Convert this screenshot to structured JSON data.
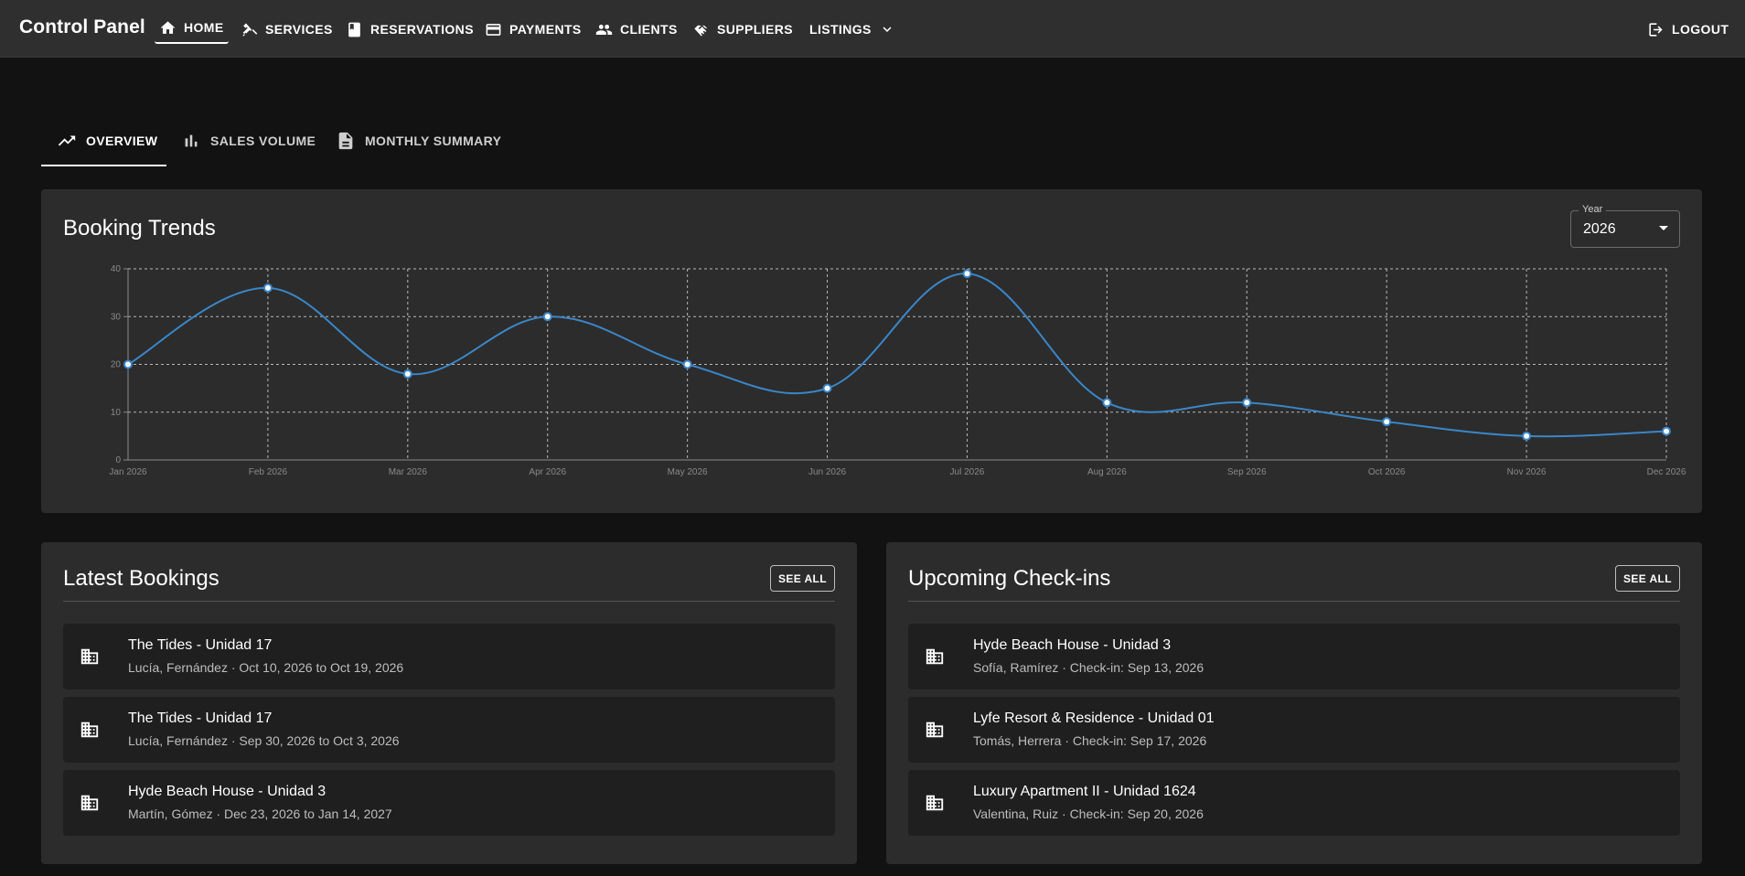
{
  "app": {
    "brand": "Control Panel",
    "nav": [
      {
        "label": "HOME",
        "icon": "home-icon"
      },
      {
        "label": "SERVICES",
        "icon": "tools-icon"
      },
      {
        "label": "RESERVATIONS",
        "icon": "book-icon"
      },
      {
        "label": "PAYMENTS",
        "icon": "credit-card-icon"
      },
      {
        "label": "CLIENTS",
        "icon": "people-icon"
      },
      {
        "label": "SUPPLIERS",
        "icon": "handshake-icon"
      },
      {
        "label": "LISTINGS",
        "icon": "chevron-down-icon"
      }
    ],
    "logout": "LOGOUT"
  },
  "tabs": [
    {
      "label": "OVERVIEW",
      "icon": "trending-up-icon"
    },
    {
      "label": "SALES VOLUME",
      "icon": "bar-chart-icon"
    },
    {
      "label": "MONTHLY SUMMARY",
      "icon": "document-icon"
    }
  ],
  "booking_trends": {
    "title": "Booking Trends",
    "year_label": "Year",
    "year_value": "2026"
  },
  "chart_data": {
    "type": "line",
    "x": [
      "Jan 2026",
      "Feb 2026",
      "Mar 2026",
      "Apr 2026",
      "May 2026",
      "Jun 2026",
      "Jul 2026",
      "Aug 2026",
      "Sep 2026",
      "Oct 2026",
      "Nov 2026",
      "Dec 2026"
    ],
    "series": [
      {
        "values": [
          20,
          36,
          18,
          30,
          20,
          15,
          39,
          12,
          12,
          8,
          5,
          6
        ]
      }
    ],
    "ylim": [
      0,
      40
    ],
    "yticks": [
      0,
      10,
      20,
      30,
      40
    ],
    "grid": true,
    "color": "#3a86c8"
  },
  "latest_bookings": {
    "title": "Latest Bookings",
    "see_all": "SEE ALL",
    "items": [
      {
        "title": "The Tides - Unidad 17",
        "subtitle": "Lucía, Fernández · Oct 10, 2026 to Oct 19, 2026"
      },
      {
        "title": "The Tides - Unidad 17",
        "subtitle": "Lucía, Fernández · Sep 30, 2026 to Oct 3, 2026"
      },
      {
        "title": "Hyde Beach House - Unidad 3",
        "subtitle": "Martín, Gómez · Dec 23, 2026 to Jan 14, 2027"
      }
    ]
  },
  "upcoming_checkins": {
    "title": "Upcoming Check-ins",
    "see_all": "SEE ALL",
    "items": [
      {
        "title": "Hyde Beach House - Unidad 3",
        "subtitle": "Sofía, Ramírez · Check-in: Sep 13, 2026"
      },
      {
        "title": "Lyfe Resort & Residence - Unidad 01",
        "subtitle": "Tomás, Herrera · Check-in: Sep 17, 2026"
      },
      {
        "title": "Luxury Apartment II - Unidad 1624",
        "subtitle": "Valentina, Ruiz · Check-in: Sep 20, 2026"
      }
    ]
  }
}
